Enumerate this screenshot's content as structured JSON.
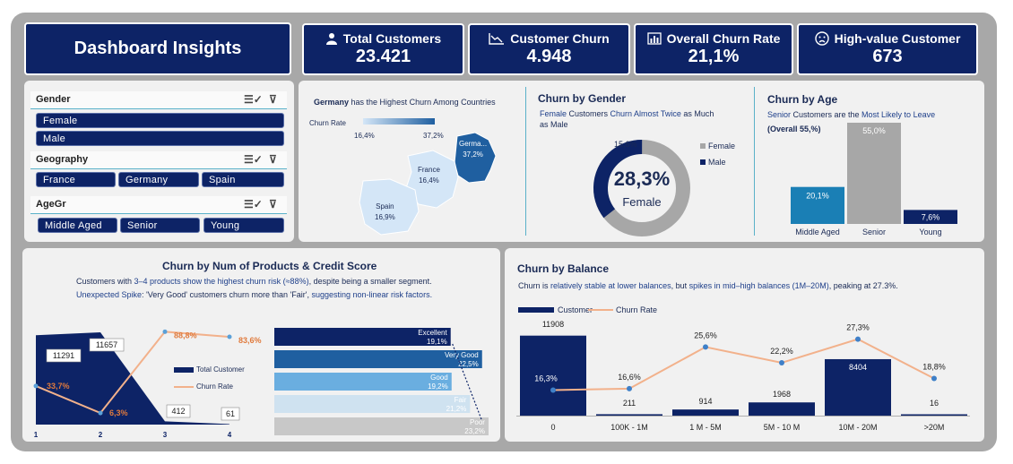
{
  "header": {
    "title": "Dashboard Insights"
  },
  "kpis": [
    {
      "label": "Total Customers",
      "value": "23.421",
      "icon": "user-icon"
    },
    {
      "label": "Customer Churn",
      "value": "4.948",
      "icon": "trend-down-icon"
    },
    {
      "label": "Overall Churn Rate",
      "value": "21,1%",
      "icon": "bar-chart-icon"
    },
    {
      "label": "High-value Customer",
      "value": "673",
      "icon": "sad-face-icon"
    }
  ],
  "slicers": {
    "gender": {
      "title": "Gender",
      "items": [
        "Female",
        "Male"
      ]
    },
    "geography": {
      "title": "Geography",
      "items": [
        "France",
        "Germany",
        "Spain"
      ]
    },
    "agegr": {
      "title": "AgeGr",
      "items": [
        "Middle Aged",
        "Senior",
        "Young"
      ]
    }
  },
  "map": {
    "title_strong": "Germany",
    "title_rest": " has the Highest Churn Among Countries",
    "legend_label": "Churn Rate",
    "legend_min": "16,4%",
    "legend_max": "37,2%",
    "countries": [
      {
        "name": "Germa...",
        "value": "37,2%",
        "color": "#1f5fa0"
      },
      {
        "name": "France",
        "value": "16,4%",
        "color": "#d4e6f7"
      },
      {
        "name": "Spain",
        "value": "16,9%",
        "color": "#d4e6f7"
      }
    ]
  },
  "gender_chart": {
    "title": "Churn by Gender",
    "subtitle_1": "Female",
    "subtitle_2": " Customers ",
    "subtitle_3": "Churn Almost Twice",
    "subtitle_4": " as Much as Male",
    "center_value": "28,3%",
    "center_label": "Female",
    "slice_label": "15,6%",
    "legend": [
      "Female",
      "Male"
    ]
  },
  "age_chart": {
    "title": "Churn by Age",
    "subtitle_1": "Senior",
    "subtitle_2": " Customers are the ",
    "subtitle_3": "Most Likely to Leave",
    "subtitle_4": "(Overall 55,%)"
  },
  "products_chart": {
    "title": "Churn by Num of Products & Credit Score",
    "line1_a": "Customers with ",
    "line1_b": "3–4 products show the highest churn risk (≈88%)",
    "line1_c": ", despite being a smaller segment.",
    "line2_a": "Unexpected Spike",
    "line2_b": ": 'Very Good' customers churn more than 'Fair', ",
    "line2_c": "suggesting non-linear risk factors.",
    "legend_total": "Total Customer",
    "legend_rate": "Churn Rate"
  },
  "balance_chart": {
    "title": "Churn by Balance",
    "sub_a": "Churn is ",
    "sub_b": "relatively stable at lower balances",
    "sub_c": ", but ",
    "sub_d": "spikes in mid–high balances (1M–20M)",
    "sub_e": ", peaking at 27.3%.",
    "legend_customer": "Customer",
    "legend_rate": "Churn Rate"
  },
  "chart_data": [
    {
      "type": "pie",
      "title": "Churn by Gender",
      "categories": [
        "Female",
        "Male"
      ],
      "values": [
        28.3,
        15.6
      ],
      "colors": [
        "#a7a7a7",
        "#0d2366"
      ]
    },
    {
      "type": "bar",
      "title": "Churn by Age",
      "categories": [
        "Middle Aged",
        "Senior",
        "Young"
      ],
      "values": [
        20.1,
        55.0,
        7.6
      ],
      "labels": [
        "20,1%",
        "55,0%",
        "7,6%"
      ],
      "colors": [
        "#1a7fb5",
        "#a7a7a7",
        "#0d2366"
      ],
      "ylim": [
        0,
        55
      ]
    },
    {
      "type": "area",
      "title": "Churn by Num of Products",
      "categories": [
        "1",
        "2",
        "3",
        "4"
      ],
      "series": [
        {
          "name": "Total Customer",
          "values": [
            11291,
            11657,
            412,
            61
          ]
        },
        {
          "name": "Churn Rate",
          "values": [
            33.7,
            6.3,
            88.8,
            83.6
          ],
          "labels": [
            "33,7%",
            "6,3%",
            "88,8%",
            "83,6%"
          ]
        }
      ],
      "ylim": [
        0,
        12000
      ]
    },
    {
      "type": "bar",
      "title": "Churn by Credit Score",
      "categories": [
        "Excellent",
        "Very Good",
        "Good",
        "Fair",
        "Poor"
      ],
      "values": [
        19.1,
        22.5,
        19.2,
        21.2,
        23.2
      ],
      "labels": [
        "19,1%",
        "22,5%",
        "19,2%",
        "21,2%",
        "23,2%"
      ],
      "colors": [
        "#0d2366",
        "#1f5fa0",
        "#6aaee0",
        "#cfe2f0",
        "#c8c8c8"
      ]
    },
    {
      "type": "bar",
      "title": "Churn by Balance",
      "categories": [
        "0",
        "100K - 1M",
        "1 M - 5M",
        "5M - 10 M",
        "10M - 20M",
        ">20M"
      ],
      "series": [
        {
          "name": "Customer",
          "values": [
            11908,
            211,
            914,
            1968,
            8404,
            16
          ]
        },
        {
          "name": "Churn Rate",
          "values": [
            16.3,
            16.6,
            25.6,
            22.2,
            27.3,
            18.8
          ],
          "labels": [
            "16,3%",
            "16,6%",
            "25,6%",
            "22,2%",
            "27,3%",
            "18,8%"
          ]
        }
      ],
      "ylim": [
        0,
        12000
      ]
    }
  ]
}
